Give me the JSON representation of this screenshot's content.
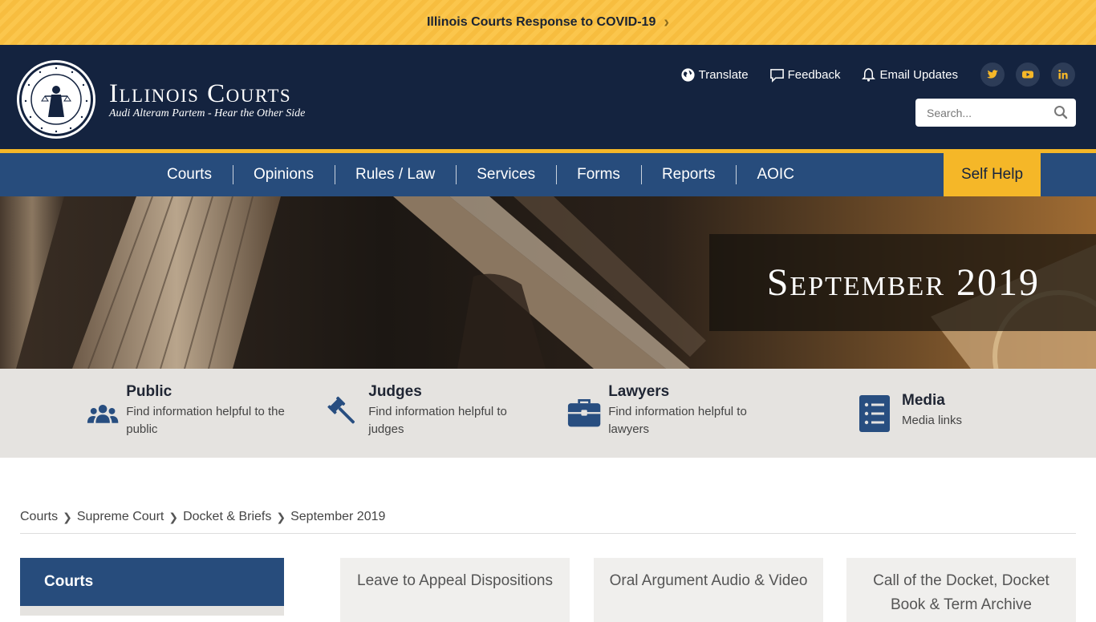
{
  "alert": {
    "text": "Illinois Courts Response to COVID-19",
    "chevron": "›"
  },
  "header": {
    "title": "Illinois Courts",
    "subtitle": "Audi Alteram Partem - Hear the Other Side",
    "utility": [
      {
        "label": "Translate",
        "icon": "globe-icon"
      },
      {
        "label": "Feedback",
        "icon": "comment-icon"
      },
      {
        "label": "Email Updates",
        "icon": "bell-icon"
      }
    ],
    "social": [
      "twitter-icon",
      "youtube-icon",
      "linkedin-icon"
    ],
    "search_placeholder": "Search..."
  },
  "nav": {
    "items": [
      "Courts",
      "Opinions",
      "Rules / Law",
      "Services",
      "Forms",
      "Reports",
      "AOIC"
    ],
    "self_help": "Self Help"
  },
  "hero": {
    "title": "September 2019"
  },
  "audience": [
    {
      "title": "Public",
      "desc": "Find information helpful to the public"
    },
    {
      "title": "Judges",
      "desc": "Find information helpful to judges"
    },
    {
      "title": "Lawyers",
      "desc": "Find information helpful to lawyers"
    },
    {
      "title": "Media",
      "desc": "Media links"
    }
  ],
  "breadcrumb": [
    "Courts",
    "Supreme Court",
    "Docket & Briefs",
    "September 2019"
  ],
  "sidebar": {
    "heading": "Courts"
  },
  "cards": [
    "Leave to Appeal Dispositions",
    "Oral Argument Audio & Video",
    "Call of the Docket, Docket Book & Term Archive"
  ],
  "colors": {
    "navy": "#14233f",
    "blue": "#274c7c",
    "gold": "#f5b728"
  }
}
